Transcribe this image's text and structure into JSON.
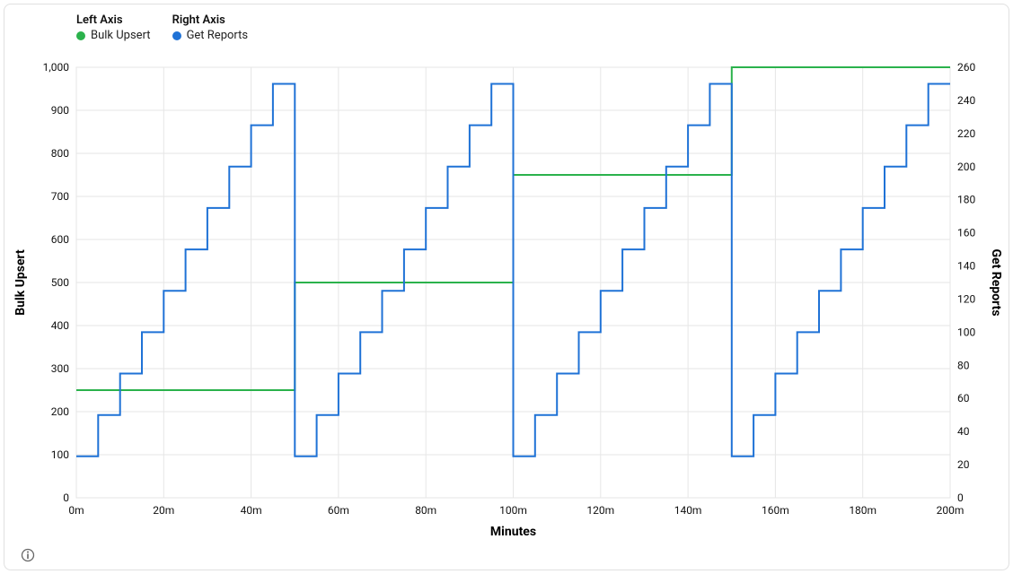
{
  "legend": {
    "left": {
      "title": "Left Axis",
      "series_label": "Bulk Upsert",
      "color": "#2BB24C"
    },
    "right": {
      "title": "Right Axis",
      "series_label": "Get Reports",
      "color": "#1F72D6"
    }
  },
  "axes": {
    "left_label": "Bulk Upsert",
    "right_label": "Get Reports",
    "bottom_label": "Minutes"
  },
  "chart_data": {
    "type": "line",
    "x_range": [
      0,
      200
    ],
    "x_ticks": [
      0,
      20,
      40,
      60,
      80,
      100,
      120,
      140,
      160,
      180,
      200
    ],
    "x_tick_suffix": "m",
    "left_axis": {
      "range": [
        0,
        1000
      ],
      "ticks": [
        0,
        100,
        200,
        300,
        400,
        500,
        600,
        700,
        800,
        900,
        1000
      ]
    },
    "right_axis": {
      "range": [
        0,
        260
      ],
      "ticks": [
        0,
        20,
        40,
        60,
        80,
        100,
        120,
        140,
        160,
        180,
        200,
        220,
        240,
        260
      ]
    },
    "series": [
      {
        "name": "Bulk Upsert",
        "axis": "left",
        "color": "#2BB24C",
        "step": true,
        "data": [
          {
            "x": 0,
            "y": 250
          },
          {
            "x": 50,
            "y": 250
          },
          {
            "x": 50,
            "y": 500
          },
          {
            "x": 100,
            "y": 500
          },
          {
            "x": 100,
            "y": 750
          },
          {
            "x": 150,
            "y": 750
          },
          {
            "x": 150,
            "y": 1000
          },
          {
            "x": 200,
            "y": 1000
          }
        ]
      },
      {
        "name": "Get Reports",
        "axis": "right",
        "color": "#1F72D6",
        "step": true,
        "data": [
          {
            "x": 0,
            "y": 25
          },
          {
            "x": 5,
            "y": 25
          },
          {
            "x": 5,
            "y": 50
          },
          {
            "x": 10,
            "y": 50
          },
          {
            "x": 10,
            "y": 75
          },
          {
            "x": 15,
            "y": 75
          },
          {
            "x": 15,
            "y": 100
          },
          {
            "x": 20,
            "y": 100
          },
          {
            "x": 20,
            "y": 125
          },
          {
            "x": 25,
            "y": 125
          },
          {
            "x": 25,
            "y": 150
          },
          {
            "x": 30,
            "y": 150
          },
          {
            "x": 30,
            "y": 175
          },
          {
            "x": 35,
            "y": 175
          },
          {
            "x": 35,
            "y": 200
          },
          {
            "x": 40,
            "y": 200
          },
          {
            "x": 40,
            "y": 225
          },
          {
            "x": 45,
            "y": 225
          },
          {
            "x": 45,
            "y": 250
          },
          {
            "x": 50,
            "y": 250
          },
          {
            "x": 50,
            "y": 25
          },
          {
            "x": 55,
            "y": 25
          },
          {
            "x": 55,
            "y": 50
          },
          {
            "x": 60,
            "y": 50
          },
          {
            "x": 60,
            "y": 75
          },
          {
            "x": 65,
            "y": 75
          },
          {
            "x": 65,
            "y": 100
          },
          {
            "x": 70,
            "y": 100
          },
          {
            "x": 70,
            "y": 125
          },
          {
            "x": 75,
            "y": 125
          },
          {
            "x": 75,
            "y": 150
          },
          {
            "x": 80,
            "y": 150
          },
          {
            "x": 80,
            "y": 175
          },
          {
            "x": 85,
            "y": 175
          },
          {
            "x": 85,
            "y": 200
          },
          {
            "x": 90,
            "y": 200
          },
          {
            "x": 90,
            "y": 225
          },
          {
            "x": 95,
            "y": 225
          },
          {
            "x": 95,
            "y": 250
          },
          {
            "x": 100,
            "y": 250
          },
          {
            "x": 100,
            "y": 25
          },
          {
            "x": 105,
            "y": 25
          },
          {
            "x": 105,
            "y": 50
          },
          {
            "x": 110,
            "y": 50
          },
          {
            "x": 110,
            "y": 75
          },
          {
            "x": 115,
            "y": 75
          },
          {
            "x": 115,
            "y": 100
          },
          {
            "x": 120,
            "y": 100
          },
          {
            "x": 120,
            "y": 125
          },
          {
            "x": 125,
            "y": 125
          },
          {
            "x": 125,
            "y": 150
          },
          {
            "x": 130,
            "y": 150
          },
          {
            "x": 130,
            "y": 175
          },
          {
            "x": 135,
            "y": 175
          },
          {
            "x": 135,
            "y": 200
          },
          {
            "x": 140,
            "y": 200
          },
          {
            "x": 140,
            "y": 225
          },
          {
            "x": 145,
            "y": 225
          },
          {
            "x": 145,
            "y": 250
          },
          {
            "x": 150,
            "y": 250
          },
          {
            "x": 150,
            "y": 25
          },
          {
            "x": 155,
            "y": 25
          },
          {
            "x": 155,
            "y": 50
          },
          {
            "x": 160,
            "y": 50
          },
          {
            "x": 160,
            "y": 75
          },
          {
            "x": 165,
            "y": 75
          },
          {
            "x": 165,
            "y": 100
          },
          {
            "x": 170,
            "y": 100
          },
          {
            "x": 170,
            "y": 125
          },
          {
            "x": 175,
            "y": 125
          },
          {
            "x": 175,
            "y": 150
          },
          {
            "x": 180,
            "y": 150
          },
          {
            "x": 180,
            "y": 175
          },
          {
            "x": 185,
            "y": 175
          },
          {
            "x": 185,
            "y": 200
          },
          {
            "x": 190,
            "y": 200
          },
          {
            "x": 190,
            "y": 225
          },
          {
            "x": 195,
            "y": 225
          },
          {
            "x": 195,
            "y": 250
          },
          {
            "x": 200,
            "y": 250
          }
        ]
      }
    ]
  }
}
